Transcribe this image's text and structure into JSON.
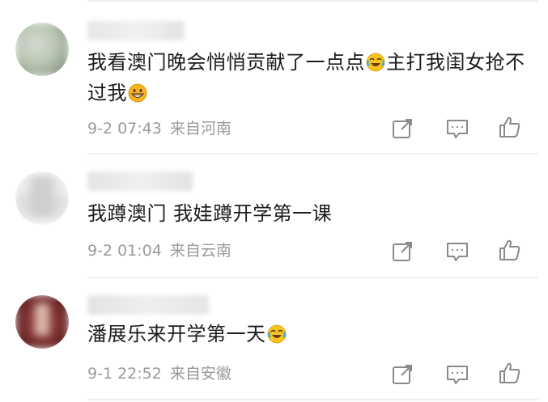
{
  "comments": [
    {
      "text_parts": [
        "我看澳门晚会悄悄贡献了一点点",
        "主打我闺女抢不过我"
      ],
      "emojis": [
        "laugh-cry-emoji",
        "grin-emoji"
      ],
      "time": "9-2 07:43",
      "location": "来自河南"
    },
    {
      "text_parts": [
        "我蹲澳门 我娃蹲开学第一课"
      ],
      "emojis": [],
      "time": "9-2 01:04",
      "location": "来自云南"
    },
    {
      "text_parts": [
        "潘展乐来开学第一天"
      ],
      "emojis": [
        "laugh-cry-emoji"
      ],
      "time": "9-1 22:52",
      "location": "来自安徽"
    }
  ],
  "icons": {
    "share": "share-icon",
    "reply": "comment-icon",
    "like": "thumbs-up-icon"
  },
  "colors": {
    "meta_text": "#9a9a9a",
    "icon_stroke": "#8a8a8a",
    "divider": "#efefef"
  }
}
